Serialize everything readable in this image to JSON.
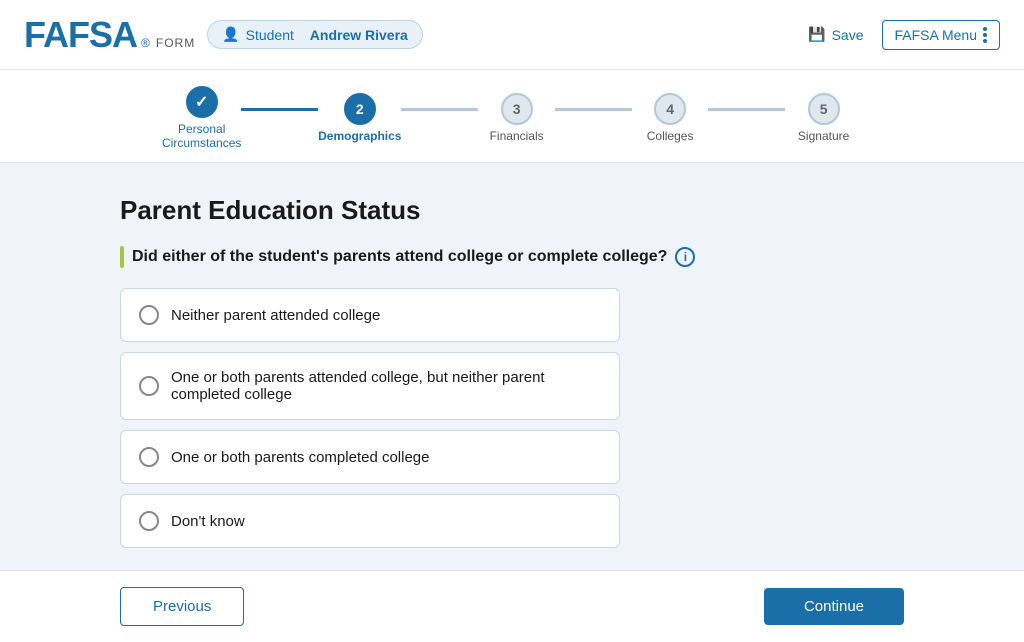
{
  "header": {
    "logo": "FAFSA",
    "logo_reg": "®",
    "logo_form": "FORM",
    "student_label": "Student",
    "student_name": "Andrew Rivera",
    "save_label": "Save",
    "menu_label": "FAFSA Menu"
  },
  "progress": {
    "steps": [
      {
        "id": 1,
        "label": "Personal Circumstances",
        "state": "completed"
      },
      {
        "id": 2,
        "label": "Demographics",
        "state": "active"
      },
      {
        "id": 3,
        "label": "Financials",
        "state": "inactive"
      },
      {
        "id": 4,
        "label": "Colleges",
        "state": "inactive"
      },
      {
        "id": 5,
        "label": "Signature",
        "state": "inactive"
      }
    ]
  },
  "page": {
    "title": "Parent Education Status",
    "question": "Did either of the student's parents attend college or complete college?",
    "info_icon_label": "i",
    "options": [
      {
        "id": "opt1",
        "label": "Neither parent attended college"
      },
      {
        "id": "opt2",
        "label": "One or both parents attended college, but neither parent completed college"
      },
      {
        "id": "opt3",
        "label": "One or both parents completed college"
      },
      {
        "id": "opt4",
        "label": "Don't know"
      }
    ]
  },
  "footer": {
    "previous_label": "Previous",
    "continue_label": "Continue"
  }
}
